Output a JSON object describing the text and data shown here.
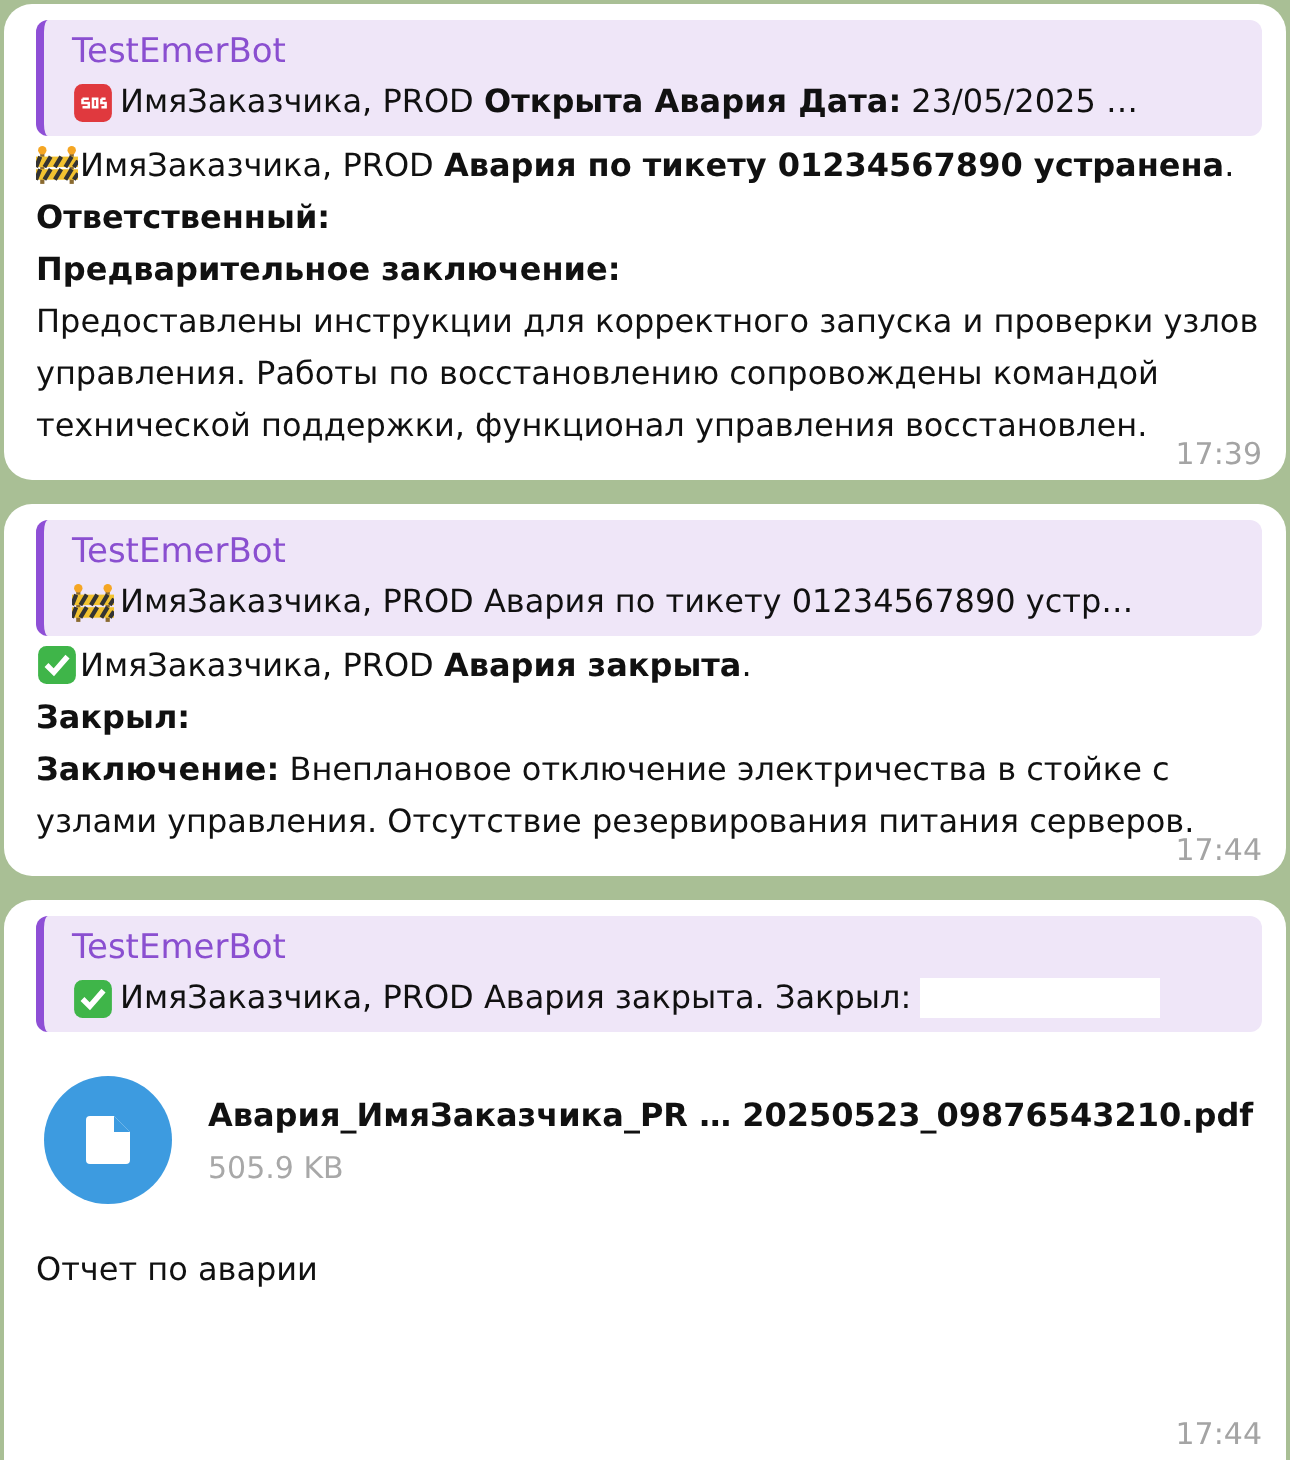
{
  "messages": [
    {
      "reply": {
        "author": "TestEmerBot",
        "text": "ИмяЗаказчика, PROD **Открыта Авария Дата:** 23/05/2025 …",
        "redacted": false
      },
      "lines": [
        {
          "kind": "text",
          "text": "ИмяЗаказчика, PROD **Авария по тикету 01234567890 устранена**."
        },
        {
          "kind": "label",
          "text": "Ответственный:"
        },
        {
          "kind": "label",
          "text": "Предварительное заключение:"
        },
        {
          "kind": "text",
          "text": "Предоставлены инструкции для корректного запуска и проверки узлов управления. Работы по восстановлению сопровождены командой технической поддержки, функционал управления восстановлен."
        }
      ],
      "time": "17:39"
    },
    {
      "reply": {
        "author": "TestEmerBot",
        "text": "ИмяЗаказчика, PROD Авария по тикету 01234567890 устр…",
        "redacted": false
      },
      "lines": [
        {
          "kind": "text",
          "text": "ИмяЗаказчика, PROD **Авария закрыта**."
        },
        {
          "kind": "label",
          "text": "Закрыл:"
        },
        {
          "kind": "text",
          "text": "**Заключение:** Внеплановое отключение электричества в стойке с узлами управления. Отсутствие резервирования питания серверов."
        }
      ],
      "time": "17:44"
    },
    {
      "reply": {
        "author": "TestEmerBot",
        "text": "ИмяЗаказчика, PROD Авария закрыта. Закрыл:",
        "redacted": true
      },
      "file": {
        "name": "Авария_ИмяЗаказчика_PR … 20250523_09876543210.pdf",
        "size": "505.9 KB"
      },
      "lines": [
        {
          "kind": "text",
          "text": "Отчет по аварии"
        }
      ],
      "time": "17:44"
    }
  ]
}
